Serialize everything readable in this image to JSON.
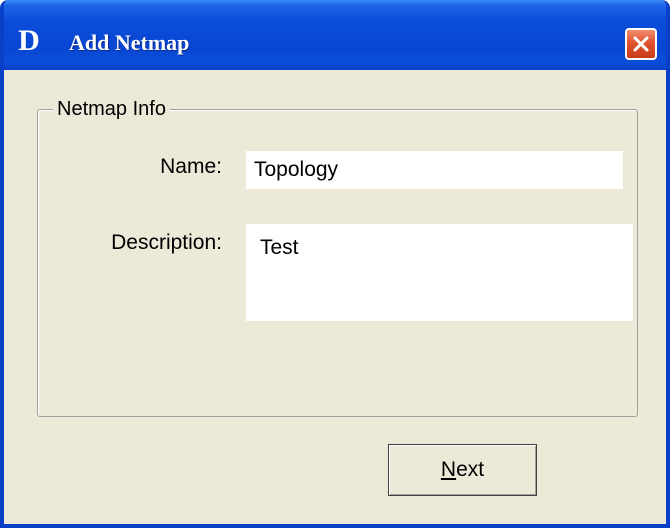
{
  "window": {
    "title": "Add Netmap",
    "logo_letter": "D"
  },
  "titlebar_buttons": {
    "close_icon": "close-x-icon"
  },
  "netmap_info": {
    "legend": "Netmap Info",
    "name_label": "Name:",
    "name_value": "Topology",
    "description_label": "Description:",
    "description_value": "Test"
  },
  "actions": {
    "next_accel": "N",
    "next_rest": "ext"
  },
  "colors": {
    "titlebar": "#0A4DDA",
    "dialog_bg": "#ECE9D8",
    "close_button": "#E2542E"
  }
}
